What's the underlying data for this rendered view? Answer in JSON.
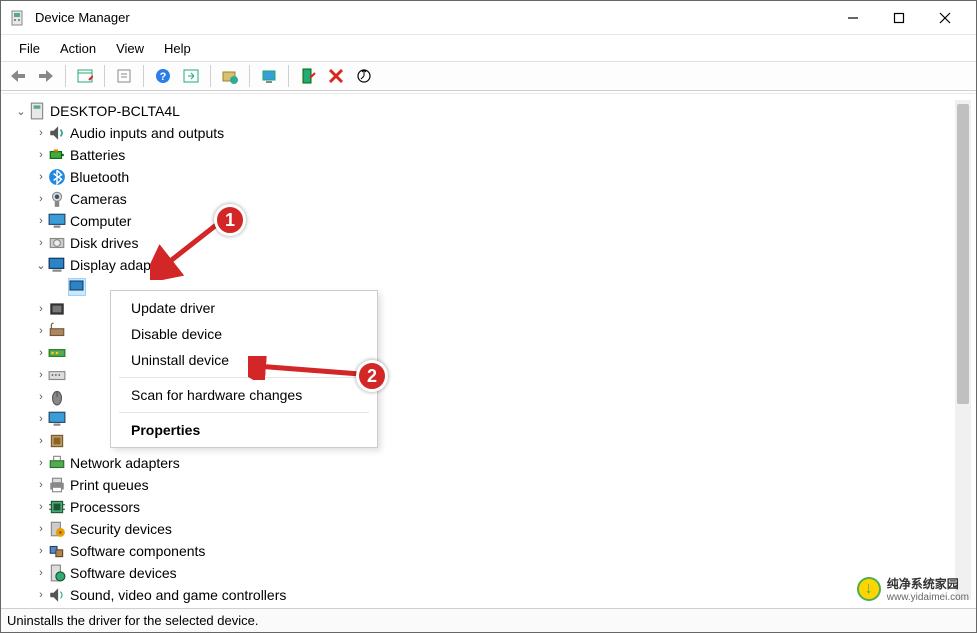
{
  "window": {
    "title": "Device Manager"
  },
  "menubar": {
    "file": "File",
    "action": "Action",
    "view": "View",
    "help": "Help"
  },
  "tree": {
    "root": "DESKTOP-BCLTA4L",
    "nodes": [
      "Audio inputs and outputs",
      "Batteries",
      "Bluetooth",
      "Cameras",
      "Computer",
      "Disk drives",
      "Display adapters",
      "",
      "",
      "",
      "",
      "",
      "",
      "",
      "",
      "Network adapters",
      "Print queues",
      "Processors",
      "Security devices",
      "Software components",
      "Software devices",
      "Sound, video and game controllers"
    ]
  },
  "context_menu": {
    "update": "Update driver",
    "disable": "Disable device",
    "uninstall": "Uninstall device",
    "scan": "Scan for hardware changes",
    "properties": "Properties"
  },
  "statusbar": {
    "text": "Uninstalls the driver for the selected device."
  },
  "annotations": {
    "badge1": "1",
    "badge2": "2"
  },
  "watermark": {
    "brand": "纯净系统家园",
    "url": "www.yidaimei.com"
  }
}
